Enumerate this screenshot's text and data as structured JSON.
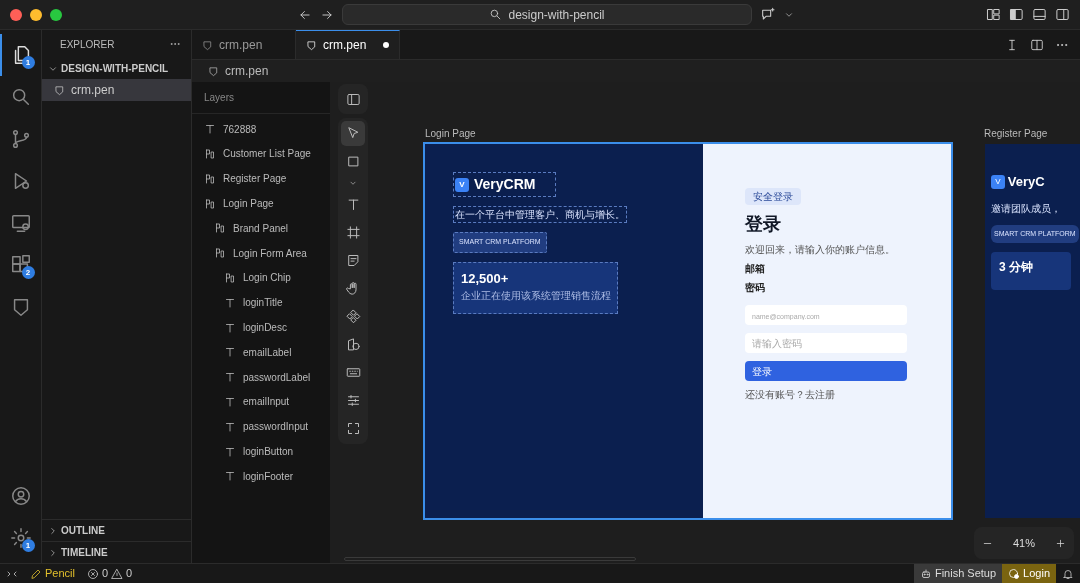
{
  "window": {
    "search": "design-with-pencil"
  },
  "activity_bar": {
    "top": [
      {
        "kind": "files",
        "badge": "1",
        "selected": true
      },
      {
        "kind": "search",
        "selected": false
      },
      {
        "kind": "source-control",
        "selected": false
      },
      {
        "kind": "run",
        "selected": false
      },
      {
        "kind": "remote",
        "selected": false
      },
      {
        "kind": "extensions",
        "badge": "2",
        "selected": false
      },
      {
        "kind": "shield",
        "selected": false
      }
    ],
    "bottom": [
      {
        "kind": "account",
        "selected": false
      },
      {
        "kind": "gear",
        "badge": "1",
        "selected": false
      }
    ]
  },
  "explorer": {
    "title": "EXPLORER",
    "section": "DESIGN-WITH-PENCIL",
    "expanded": true,
    "files": [
      {
        "name": "crm.pen",
        "selected": true
      }
    ],
    "panels": [
      {
        "label": "OUTLINE",
        "expanded": false
      },
      {
        "label": "TIMELINE",
        "expanded": false
      }
    ]
  },
  "tabs": [
    {
      "label": "crm.pen",
      "selected": false,
      "modified": false
    },
    {
      "label": "crm.pen",
      "selected": true,
      "modified": true
    }
  ],
  "breadcrumb": "crm.pen",
  "layers": {
    "title": "Layers",
    "items": [
      {
        "kind": "text",
        "name": "762888"
      },
      {
        "kind": "frame",
        "name": "Customer List Page"
      },
      {
        "kind": "frame",
        "name": "Register Page"
      },
      {
        "kind": "frame",
        "name": "Login Page",
        "children": [
          {
            "kind": "frame",
            "name": "Brand Panel"
          },
          {
            "kind": "frame",
            "name": "Login Form Area",
            "children": [
              {
                "kind": "frame",
                "name": "Login Chip"
              },
              {
                "kind": "text",
                "name": "loginTitle"
              },
              {
                "kind": "text",
                "name": "loginDesc"
              },
              {
                "kind": "text",
                "name": "emailLabel"
              },
              {
                "kind": "text",
                "name": "passwordLabel"
              },
              {
                "kind": "text",
                "name": "emailInput"
              },
              {
                "kind": "text",
                "name": "passwordInput"
              },
              {
                "kind": "text",
                "name": "loginButton"
              },
              {
                "kind": "text",
                "name": "loginFooter"
              }
            ]
          }
        ]
      }
    ]
  },
  "tools": [
    {
      "kind": "select",
      "selected": true
    },
    {
      "kind": "rectangle",
      "selected": false
    },
    {
      "kind": "chevron",
      "selected": false
    },
    {
      "kind": "text",
      "selected": false
    },
    {
      "kind": "frame",
      "selected": false
    },
    {
      "kind": "note",
      "selected": false
    },
    {
      "kind": "hand",
      "selected": false
    },
    {
      "kind": "component",
      "selected": false
    },
    {
      "kind": "shapes",
      "selected": false
    },
    {
      "kind": "keyboard",
      "selected": false
    },
    {
      "kind": "sliders",
      "selected": false
    },
    {
      "kind": "fit",
      "selected": false
    }
  ],
  "canvas": {
    "login_page": {
      "label": "Login Page",
      "selected": true,
      "brand": {
        "logo": "V",
        "name": "VeryCRM",
        "tagline": "在一个平台中管理客户、商机与增长。",
        "chip": "SMART CRM PLATFORM",
        "stat": "12,500+",
        "stat_desc": "企业正在使用该系统管理销售流程"
      },
      "form": {
        "chip": "安全登录",
        "title": "登录",
        "desc": "欢迎回来，请输入你的账户信息。",
        "email_label": "邮箱",
        "password_label": "密码",
        "email_placeholder": "name@company.com",
        "password_placeholder": "请输入密码",
        "button": "登录",
        "footer": "还没有账号？去注册"
      }
    },
    "register_page": {
      "label": "Register Page",
      "logo": "V",
      "name": "VeryC",
      "tagline": "邀请团队成员，",
      "chip": "SMART CRM PLATFORM",
      "stat": "3 分钟"
    }
  },
  "zoom": {
    "value": "41%"
  },
  "status_bar": {
    "brand": "Pencil",
    "errors": "0",
    "warnings": "0",
    "items": [
      {
        "kind": "setup",
        "label": "Finish Setup"
      },
      {
        "kind": "login",
        "label": "Login"
      }
    ]
  }
}
